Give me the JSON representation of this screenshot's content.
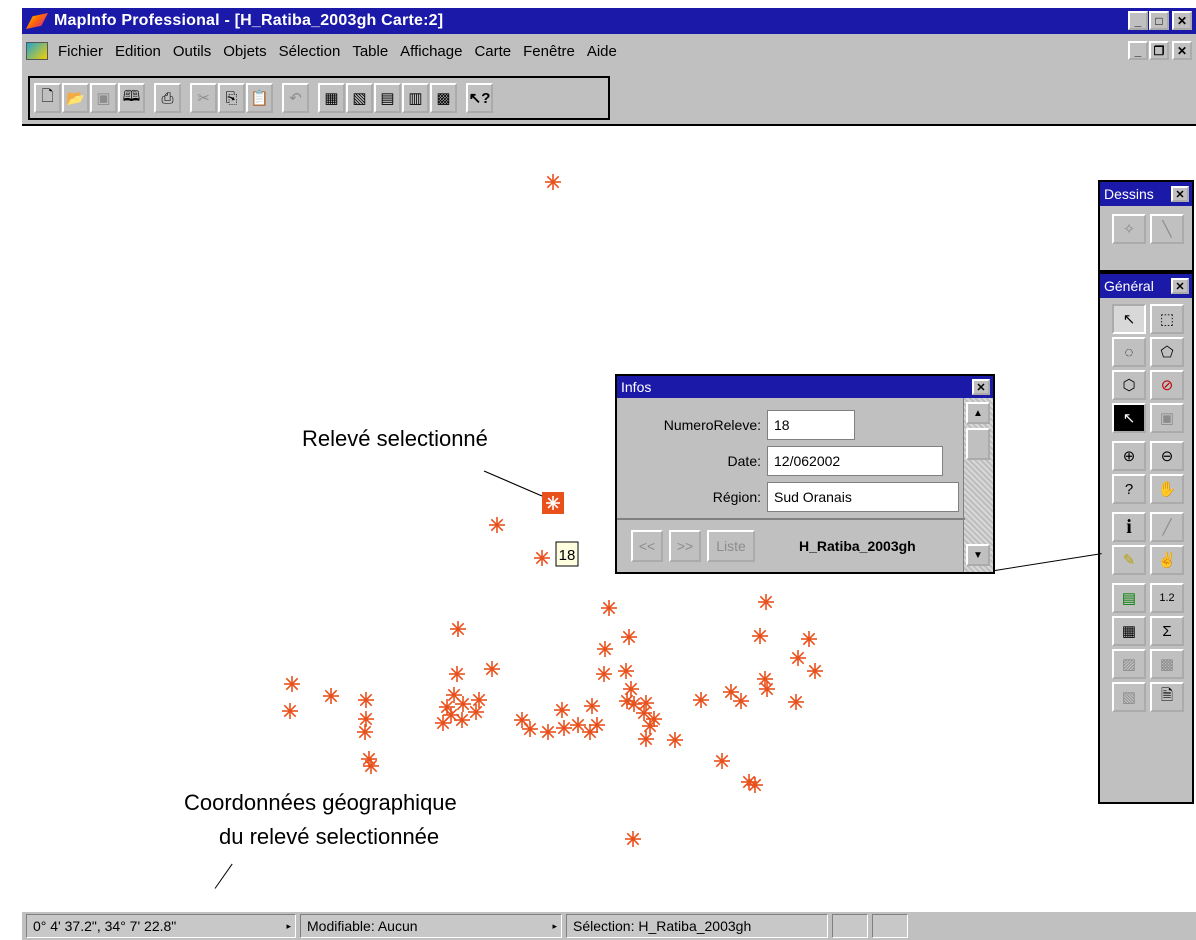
{
  "window": {
    "title": "MapInfo Professional - [H_Ratiba_2003gh Carte:2]",
    "controls": [
      "minimize",
      "maximize",
      "close"
    ]
  },
  "menu": {
    "items": [
      "Fichier",
      "Edition",
      "Outils",
      "Objets",
      "Sélection",
      "Table",
      "Affichage",
      "Carte",
      "Fenêtre",
      "Aide"
    ]
  },
  "toolbar": {
    "buttons": [
      "new-document-icon",
      "open-folder-icon",
      "save-icon",
      "open-workspace-icon",
      "print-icon",
      "cut-icon",
      "copy-icon",
      "paste-icon",
      "undo-icon",
      "new-browser-icon",
      "new-map-icon",
      "new-graph-icon",
      "new-layout-icon",
      "new-redistrict-icon",
      "help-pointer-icon"
    ]
  },
  "palettes": {
    "dessins": {
      "title": "Dessins"
    },
    "general": {
      "title": "Général",
      "tools": [
        "select-arrow-icon",
        "marquee-select-icon",
        "radius-select-icon",
        "polygon-select-icon",
        "boundary-select-icon",
        "unselect-all-icon",
        "graph-select-icon",
        "invert-selection-icon",
        "zoom-in-icon",
        "zoom-out-icon",
        "change-view-icon",
        "grabber-hand-icon",
        "info-tool-icon",
        "ruler-icon",
        "label-tool-icon",
        "drag-window-icon",
        "layer-control-icon",
        "show-legend-icon",
        "browser-statistics-icon",
        "sigma-statistics-icon",
        "hotlink-icon",
        "run-query-icon",
        "graph-tool-icon",
        "layout-tool-icon"
      ]
    }
  },
  "infos": {
    "title": "Infos",
    "fields": [
      {
        "label": "NumeroReleve:",
        "value": "18"
      },
      {
        "label": "Date:",
        "value": "12/062002"
      },
      {
        "label": "Région:",
        "value": "Sud Oranais"
      }
    ],
    "nav_prev": "<<",
    "nav_next": ">>",
    "nav_list": "Liste",
    "table_name": "H_Ratiba_2003gh"
  },
  "map": {
    "point_color": "#e8501c",
    "selected_color": "#e8501c",
    "selected_label": "18",
    "caption_selected": "Relevé selectionné",
    "caption_coords_line1": "Coordonnées géographique",
    "caption_coords_line2": "du relevé selectionnée"
  },
  "status": {
    "coords": "0° 4' 37.2\", 34° 7' 22.8\"",
    "editable": "Modifiable: Aucun",
    "selection": "Sélection: H_Ratiba_2003gh"
  }
}
